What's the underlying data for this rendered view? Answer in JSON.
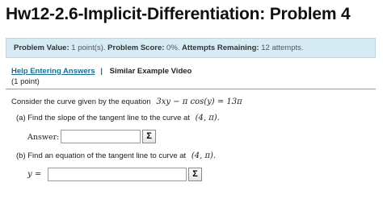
{
  "page": {
    "title": "Hw12-2.6-Implicit-Differentiation: Problem 4"
  },
  "info": {
    "value_label": "Problem Value:",
    "value_text": "1 point(s).",
    "score_label": "Problem Score:",
    "score_text": "0%.",
    "attempts_label": "Attempts Remaining:",
    "attempts_text": "12 attempts."
  },
  "links": {
    "help": "Help Entering Answers",
    "separator": "|",
    "video": "Similar Example Video"
  },
  "problem": {
    "points": "(1 point)",
    "prompt": "Consider the curve given by the equation",
    "equation": "3xy − π cos(y) = 13π",
    "part_a": "(a) Find the slope of the tangent line to the curve at",
    "part_a_point": "(4, π).",
    "part_b": "(b) Find an equation of the tangent line to curve at",
    "part_b_point": "(4, π).",
    "answer_label": "Answer:",
    "y_label": "y =",
    "answer_a_value": "",
    "answer_b_value": "",
    "sigma_symbol": "Σ"
  },
  "colors": {
    "info_bg": "#d7ebf5",
    "link": "#1d6c92"
  },
  "icons": [
    "sigma-icon"
  ]
}
